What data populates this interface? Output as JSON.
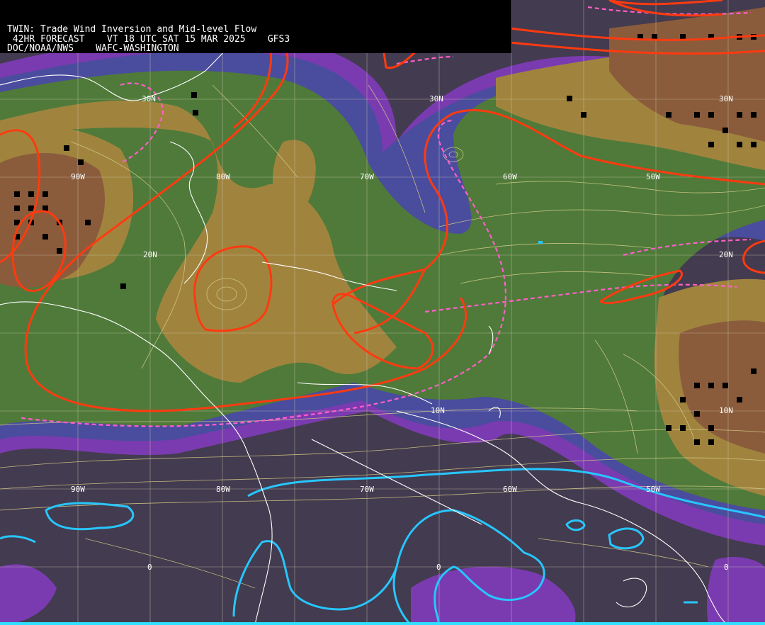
{
  "header": {
    "line1": "TWIN: Trade Wind Inversion and Mid-level Flow",
    "line2": " 42HR FORECAST    VT 18 UTC SAT 15 MAR 2025    GFS3",
    "line3": "DOC/NOAA/NWS    WAFC-WASHINGTON"
  },
  "grid_labels": {
    "lon_top": [
      "90W",
      "80W",
      "70W",
      "60W",
      "50W"
    ],
    "lon_bottom": [
      "90W",
      "80W",
      "70W",
      "60W",
      "50W"
    ],
    "lat_east": [
      "30N",
      "20N",
      "10N",
      "0"
    ],
    "lat_west": [
      "30N",
      "20N",
      "0"
    ],
    "lat_mid": [
      "0"
    ]
  },
  "colors": {
    "background": "#433b4f",
    "purple": "#7a3bb0",
    "blue": "#4a4c9e",
    "green": "#4f7a3a",
    "light_green": "#6f8a3a",
    "tan": "#a0843e",
    "brown": "#8a5c3c",
    "contour_red": "#ff3a10",
    "contour_blue": "#27c6ff",
    "dashed_pink": "#ff5fc8",
    "streamline": "#d8cf8a",
    "coast": "#ffffff",
    "grid": "#cfc8b0",
    "marker": "#000000"
  }
}
